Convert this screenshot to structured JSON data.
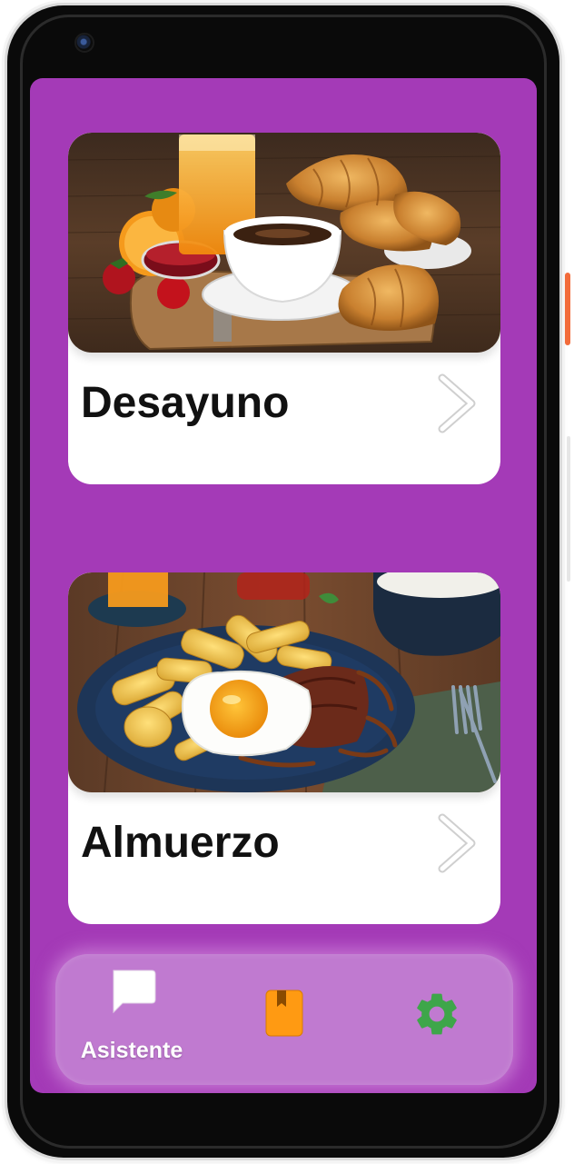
{
  "meals": [
    {
      "name": "Desayuno",
      "image": "breakfast-photo"
    },
    {
      "name": "Almuerzo",
      "image": "lunch-photo"
    }
  ],
  "navbar": {
    "items": [
      {
        "id": "assistant",
        "label": "Asistente",
        "icon": "chat-bubble-icon",
        "active": true,
        "color": "#ffffff"
      },
      {
        "id": "recipes",
        "label": "",
        "icon": "book-icon",
        "active": false,
        "color": "#ff9a12"
      },
      {
        "id": "settings",
        "label": "",
        "icon": "gear-icon",
        "active": false,
        "color": "#3ea64a"
      }
    ]
  },
  "colors": {
    "screen_background": "#a43ab7",
    "navbar_background": "#c07ad0",
    "card_background": "#ffffff"
  }
}
